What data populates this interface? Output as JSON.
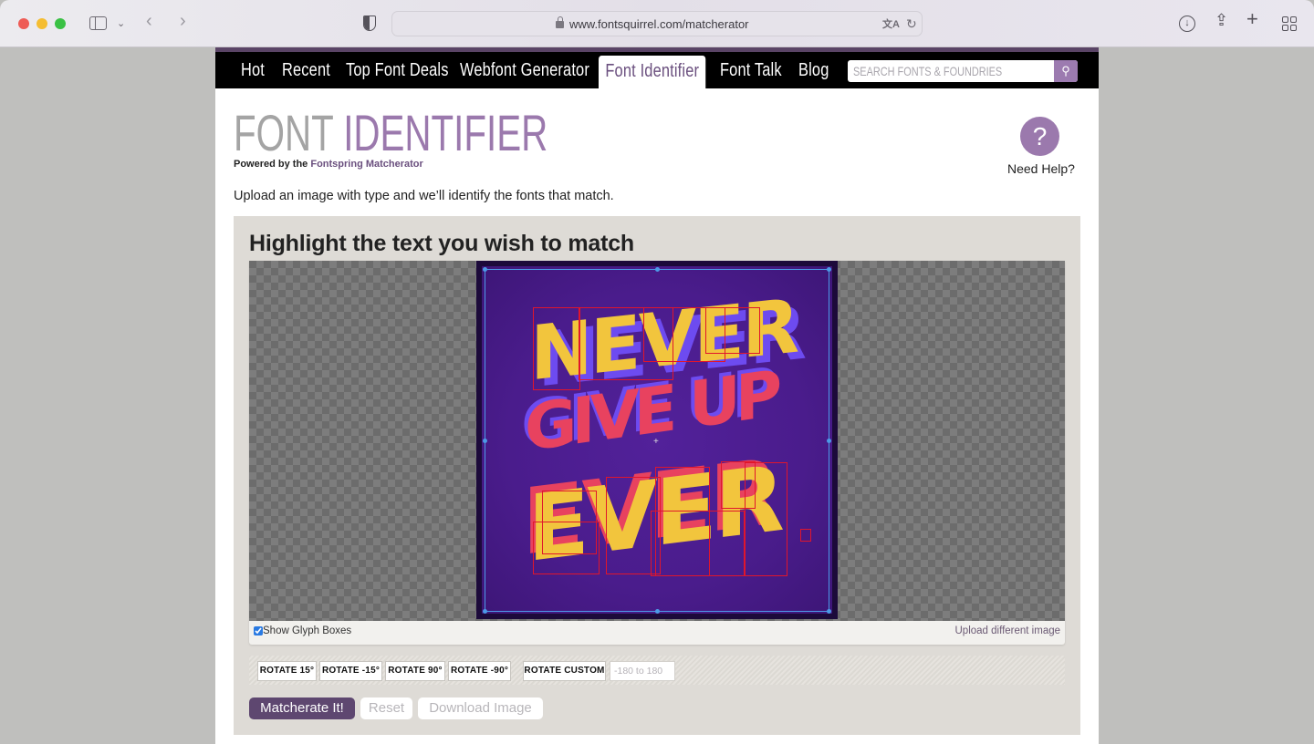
{
  "browser": {
    "url": "www.fontsquirrel.com/matcherator",
    "icons": [
      "sidebar-icon",
      "chevron-down-icon",
      "back-icon",
      "forward-icon",
      "shield-icon",
      "lock-icon",
      "translate-icon",
      "reload-icon",
      "download-icon",
      "share-icon",
      "new-tab-icon",
      "tab-overview-icon"
    ]
  },
  "nav": {
    "items": [
      {
        "label": "Hot",
        "active": false
      },
      {
        "label": "Recent",
        "active": false
      },
      {
        "label": "Top Font Deals",
        "active": false
      },
      {
        "label": "Webfont Generator",
        "active": false
      },
      {
        "label": "Font Identifier",
        "active": true
      },
      {
        "label": "Font Talk",
        "active": false
      },
      {
        "label": "Blog",
        "active": false
      }
    ],
    "search_placeholder": "SEARCH FONTS & FOUNDRIES"
  },
  "header": {
    "title_part1": "FONT",
    "title_part2": "IDENTIFIER",
    "powered_prefix": "Powered by the",
    "powered_link": "Fontspring Matcherator",
    "help_symbol": "?",
    "help_label": "Need Help?",
    "intro": "Upload an image with type and we’ll identify the fonts that match."
  },
  "panel": {
    "title": "Highlight the text you wish to match",
    "artwork": {
      "lines": [
        "NEVER",
        "GIVE UP",
        "EVER"
      ],
      "colors": {
        "background": "#4a1c8c",
        "yellow": "#f2c53d",
        "pink": "#e8425f",
        "violet": "#6d4bf0",
        "glyph_box": "#e0162c",
        "selection": "#4c9ae6"
      }
    },
    "show_glyph_boxes_label": "Show Glyph Boxes",
    "show_glyph_boxes_checked": true,
    "upload_link": "Upload different image",
    "rotate_buttons": [
      "ROTATE 15°",
      "ROTATE -15°",
      "ROTATE 90°",
      "ROTATE -90°"
    ],
    "rotate_custom_label": "ROTATE CUSTOM",
    "rotate_custom_placeholder": "-180 to 180",
    "actions": {
      "matcherate": "Matcherate It!",
      "reset": "Reset",
      "download": "Download Image"
    }
  },
  "colors": {
    "brand_purple": "#9b79ad",
    "dark_purple": "#5e4770",
    "nav_bg": "#000000"
  }
}
